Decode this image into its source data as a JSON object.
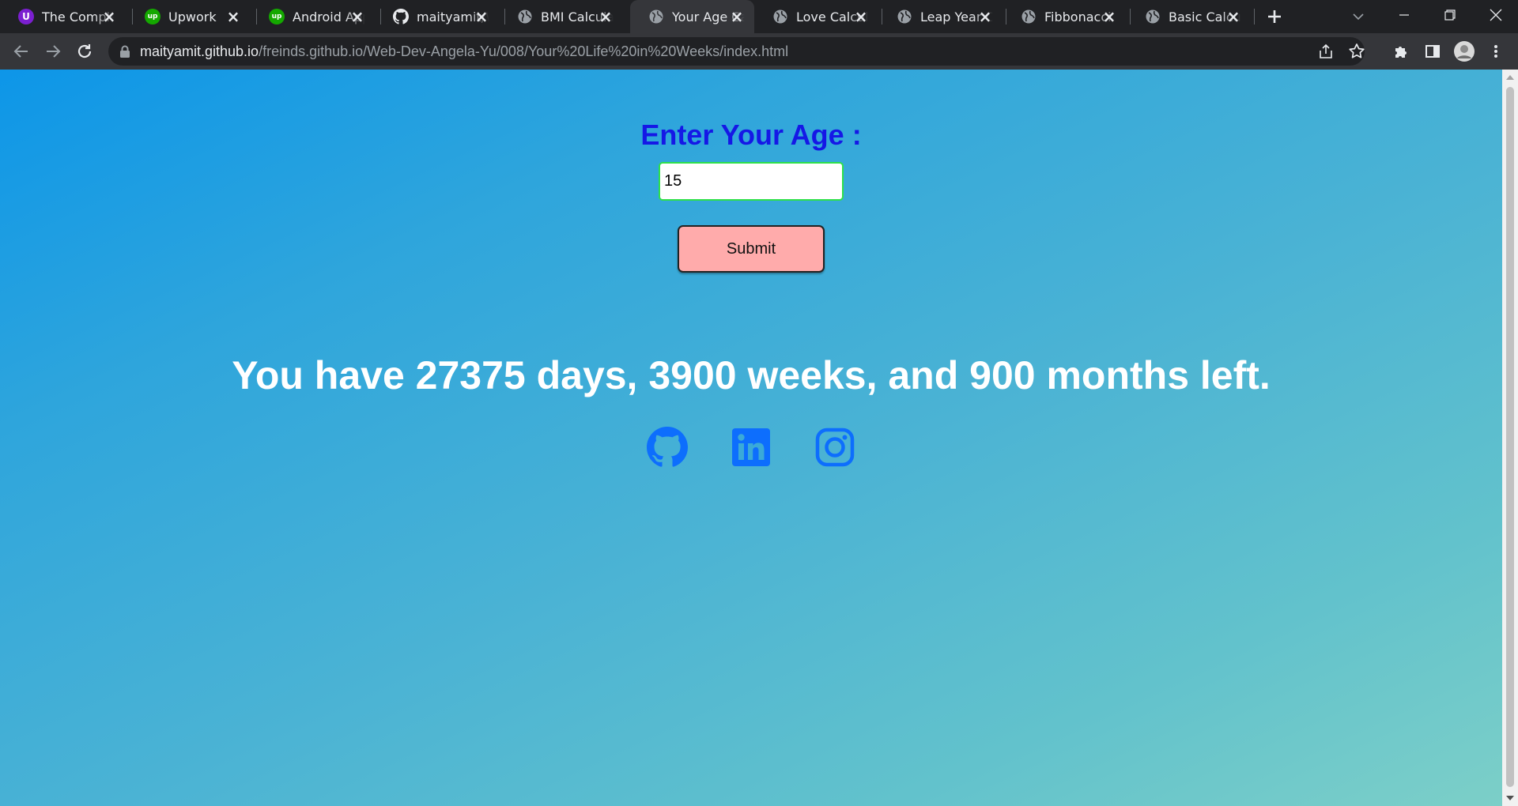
{
  "browser": {
    "tabs": [
      {
        "title": "The Complete",
        "favicon": "purple-shield-icon",
        "active": false
      },
      {
        "title": "Upwork",
        "favicon": "upwork-icon",
        "active": false
      },
      {
        "title": "Android App",
        "favicon": "upwork-icon",
        "active": false
      },
      {
        "title": "maityamit/Web",
        "favicon": "github-icon",
        "active": false
      },
      {
        "title": "BMI Calculator",
        "favicon": "globe-icon",
        "active": false
      },
      {
        "title": "Your Age Calculator",
        "favicon": "globe-icon",
        "active": true
      },
      {
        "title": "Love Calculator",
        "favicon": "globe-icon",
        "active": false
      },
      {
        "title": "Leap Year Calculator",
        "favicon": "globe-icon",
        "active": false
      },
      {
        "title": "Fibbonacci",
        "favicon": "globe-icon",
        "active": false
      },
      {
        "title": "Basic Calculator",
        "favicon": "globe-icon",
        "active": false
      }
    ],
    "url_host": "maityamit.github.io",
    "url_path": "/freinds.github.io/Web-Dev-Angela-Yu/008/Your%20Life%20in%20Weeks/index.html"
  },
  "page": {
    "heading": "Enter Your Age :",
    "age_value": "15",
    "submit_label": "Submit",
    "result_text": "You have 27375 days, 3900 weeks, and 900 months left.",
    "social_links": [
      "github-icon",
      "linkedin-icon",
      "instagram-icon"
    ]
  },
  "colors": {
    "heading": "#1518e6",
    "input_border": "#2ee04a",
    "button_bg": "#ffabab",
    "social_icon": "#0d6efd",
    "gradient_start": "#0d96e8",
    "gradient_end": "#7ccfc8"
  }
}
